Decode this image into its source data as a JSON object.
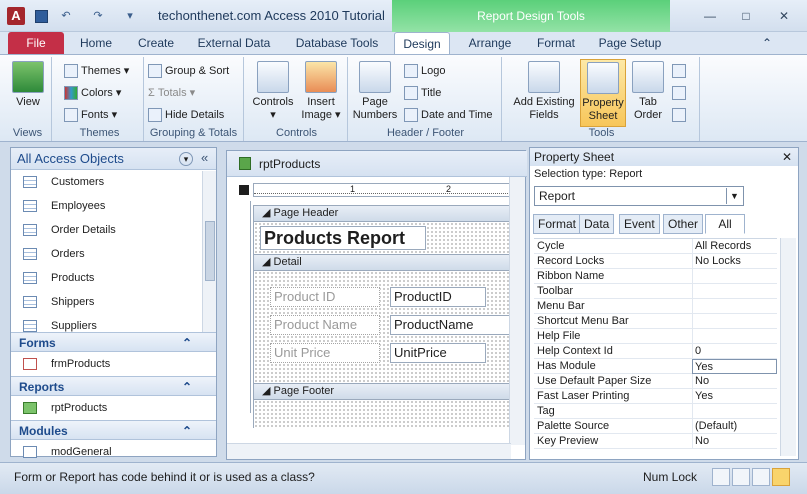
{
  "window": {
    "title": "techonthenet.com Access 2010 Tutorial",
    "context_tools": "Report Design Tools",
    "icon_letter": "A"
  },
  "tabs": [
    "File",
    "Home",
    "Create",
    "External Data",
    "Database Tools",
    "Design",
    "Arrange",
    "Format",
    "Page Setup"
  ],
  "ribbon": {
    "views": {
      "label": "Views",
      "view": "View"
    },
    "themes": {
      "label": "Themes",
      "themes": "Themes",
      "colors": "Colors",
      "fonts": "Fonts"
    },
    "grouping": {
      "label": "Grouping & Totals",
      "group_sort": "Group & Sort",
      "totals": "Totals",
      "hide_details": "Hide Details"
    },
    "controls": {
      "label": "Controls",
      "controls": "Controls",
      "insert_image": "Insert Image"
    },
    "header_footer": {
      "label": "Header / Footer",
      "page_numbers": "Page Numbers",
      "logo": "Logo",
      "title": "Title",
      "date_time": "Date and Time"
    },
    "tools": {
      "label": "Tools",
      "add_fields": "Add Existing Fields",
      "property_sheet": "Property Sheet",
      "tab_order": "Tab Order"
    }
  },
  "nav": {
    "title": "All Access Objects",
    "tables": [
      "Customers",
      "Employees",
      "Order Details",
      "Orders",
      "Products",
      "Shippers",
      "Suppliers"
    ],
    "sections": [
      {
        "name": "Forms",
        "items": [
          "frmProducts"
        ]
      },
      {
        "name": "Reports",
        "items": [
          "rptProducts"
        ]
      },
      {
        "name": "Modules",
        "items": [
          "modGeneral"
        ]
      }
    ]
  },
  "report": {
    "name": "rptProducts",
    "ruler": [
      "1",
      "2"
    ],
    "page_header": "Page Header",
    "title": "Products Report",
    "detail": "Detail",
    "page_footer": "Page Footer",
    "fields": [
      {
        "label": "Product ID",
        "value": "ProductID"
      },
      {
        "label": "Product Name",
        "value": "ProductName"
      },
      {
        "label": "Unit Price",
        "value": "UnitPrice"
      }
    ]
  },
  "property_sheet": {
    "title": "Property Sheet",
    "selection_type": "Selection type:  Report",
    "selected": "Report",
    "tabs": [
      "Format",
      "Data",
      "Event",
      "Other",
      "All"
    ],
    "rows": [
      {
        "name": "Cycle",
        "value": "All Records"
      },
      {
        "name": "Record Locks",
        "value": "No Locks"
      },
      {
        "name": "Ribbon Name",
        "value": ""
      },
      {
        "name": "Toolbar",
        "value": ""
      },
      {
        "name": "Menu Bar",
        "value": ""
      },
      {
        "name": "Shortcut Menu Bar",
        "value": ""
      },
      {
        "name": "Help File",
        "value": ""
      },
      {
        "name": "Help Context Id",
        "value": "0"
      },
      {
        "name": "Has Module",
        "value": "Yes"
      },
      {
        "name": "Use Default Paper Size",
        "value": "No"
      },
      {
        "name": "Fast Laser Printing",
        "value": "Yes"
      },
      {
        "name": "Tag",
        "value": ""
      },
      {
        "name": "Palette Source",
        "value": "(Default)"
      },
      {
        "name": "Key Preview",
        "value": "No"
      }
    ]
  },
  "status": {
    "text": "Form or Report has code behind it or is used as a class?",
    "num_lock": "Num Lock"
  }
}
